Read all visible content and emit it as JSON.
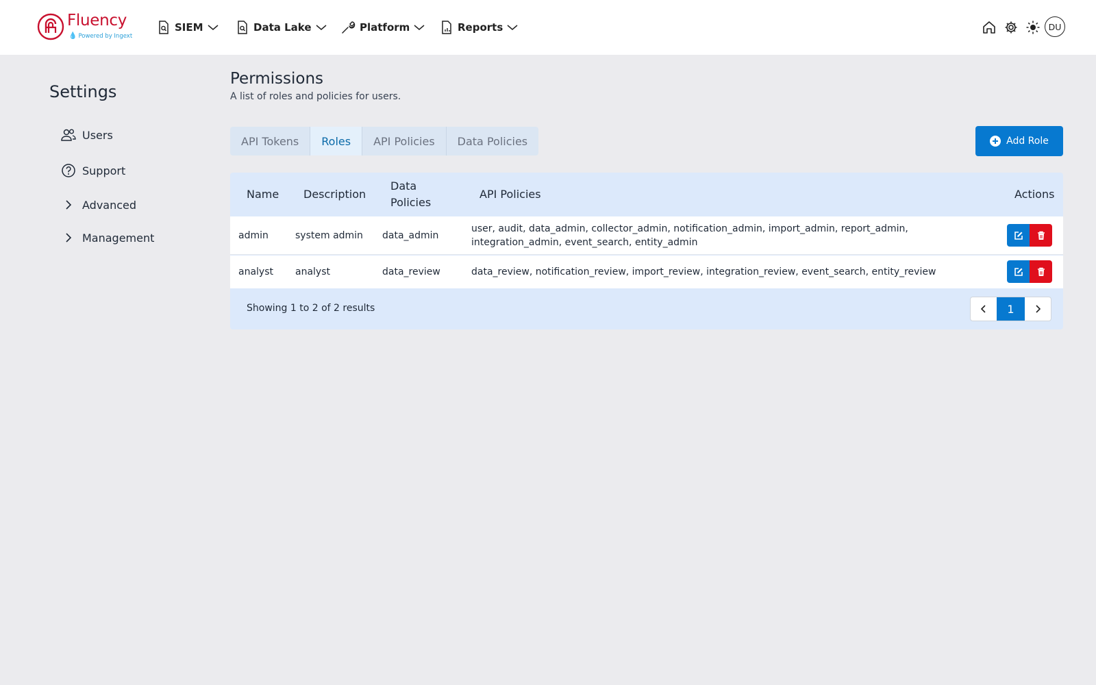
{
  "brand": {
    "name": "Fluency",
    "sub": "Powered by Ingext",
    "color": "#c8102e"
  },
  "nav": {
    "items": [
      {
        "label": "SIEM",
        "icon": "search-doc-icon"
      },
      {
        "label": "Data Lake",
        "icon": "search-doc-icon"
      },
      {
        "label": "Platform",
        "icon": "wrench-icon"
      },
      {
        "label": "Reports",
        "icon": "report-doc-icon"
      }
    ],
    "user_initials": "DU"
  },
  "sidebar": {
    "title": "Settings",
    "items": [
      {
        "label": "Users",
        "icon": "users-icon"
      },
      {
        "label": "Support",
        "icon": "help-circle-icon"
      },
      {
        "label": "Advanced",
        "icon": "chevron-right-icon"
      },
      {
        "label": "Management",
        "icon": "chevron-right-icon"
      }
    ]
  },
  "main": {
    "title": "Permissions",
    "subtitle": "A list of roles and policies for users.",
    "tabs": [
      {
        "label": "API Tokens",
        "active": false
      },
      {
        "label": "Roles",
        "active": true
      },
      {
        "label": "API Policies",
        "active": false
      },
      {
        "label": "Data Policies",
        "active": false
      }
    ],
    "add_button": "Add Role"
  },
  "table": {
    "columns": [
      "Name",
      "Description",
      "Data Policies",
      "API Policies",
      "Actions"
    ],
    "rows": [
      {
        "name": "admin",
        "description": "system admin",
        "data_policies": "data_admin",
        "api_policies_line1": "user, audit, data_admin, collector_admin, notification_admin, import_admin, report_admin,",
        "api_policies_line2": "integration_admin, event_search, entity_admin"
      },
      {
        "name": "analyst",
        "description": "analyst",
        "data_policies": "data_review",
        "api_policies_line1": "data_review, notification_review, import_review, integration_review, event_search, entity_review"
      }
    ],
    "footer": "Showing 1 to 2 of 2 results",
    "current_page": "1"
  },
  "colors": {
    "primary": "#0779d0",
    "danger": "#e00f1c",
    "background": "#ebebee",
    "table_header": "#dce9fb"
  }
}
